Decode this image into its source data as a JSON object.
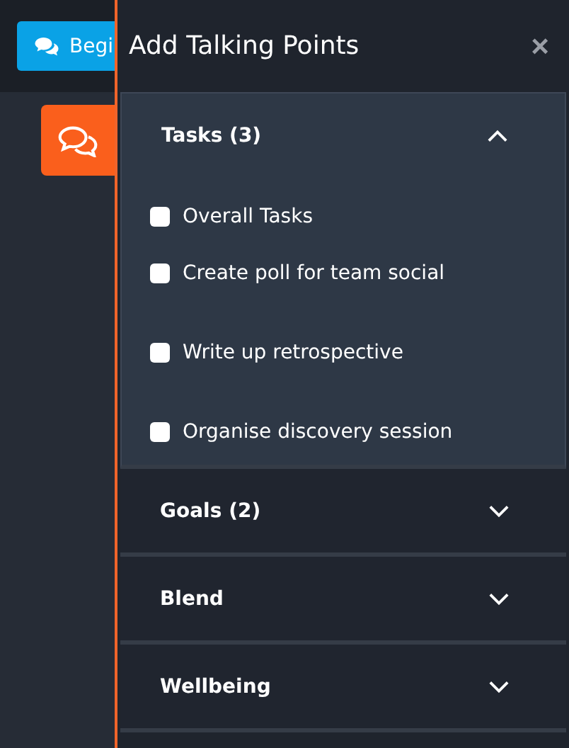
{
  "background": {
    "begin_button": "Begi"
  },
  "panel": {
    "title": "Add Talking Points",
    "close": "×"
  },
  "sections": [
    {
      "title": "Tasks (3)",
      "expanded": true,
      "items": [
        {
          "label": "Overall Tasks",
          "checked": false
        },
        {
          "label": "Create poll for team social",
          "checked": false
        },
        {
          "label": "Write up retrospective",
          "checked": false
        },
        {
          "label": "Organise discovery session",
          "checked": false
        }
      ]
    },
    {
      "title": "Goals (2)",
      "expanded": false
    },
    {
      "title": "Blend",
      "expanded": false
    },
    {
      "title": "Wellbeing",
      "expanded": false
    }
  ]
}
